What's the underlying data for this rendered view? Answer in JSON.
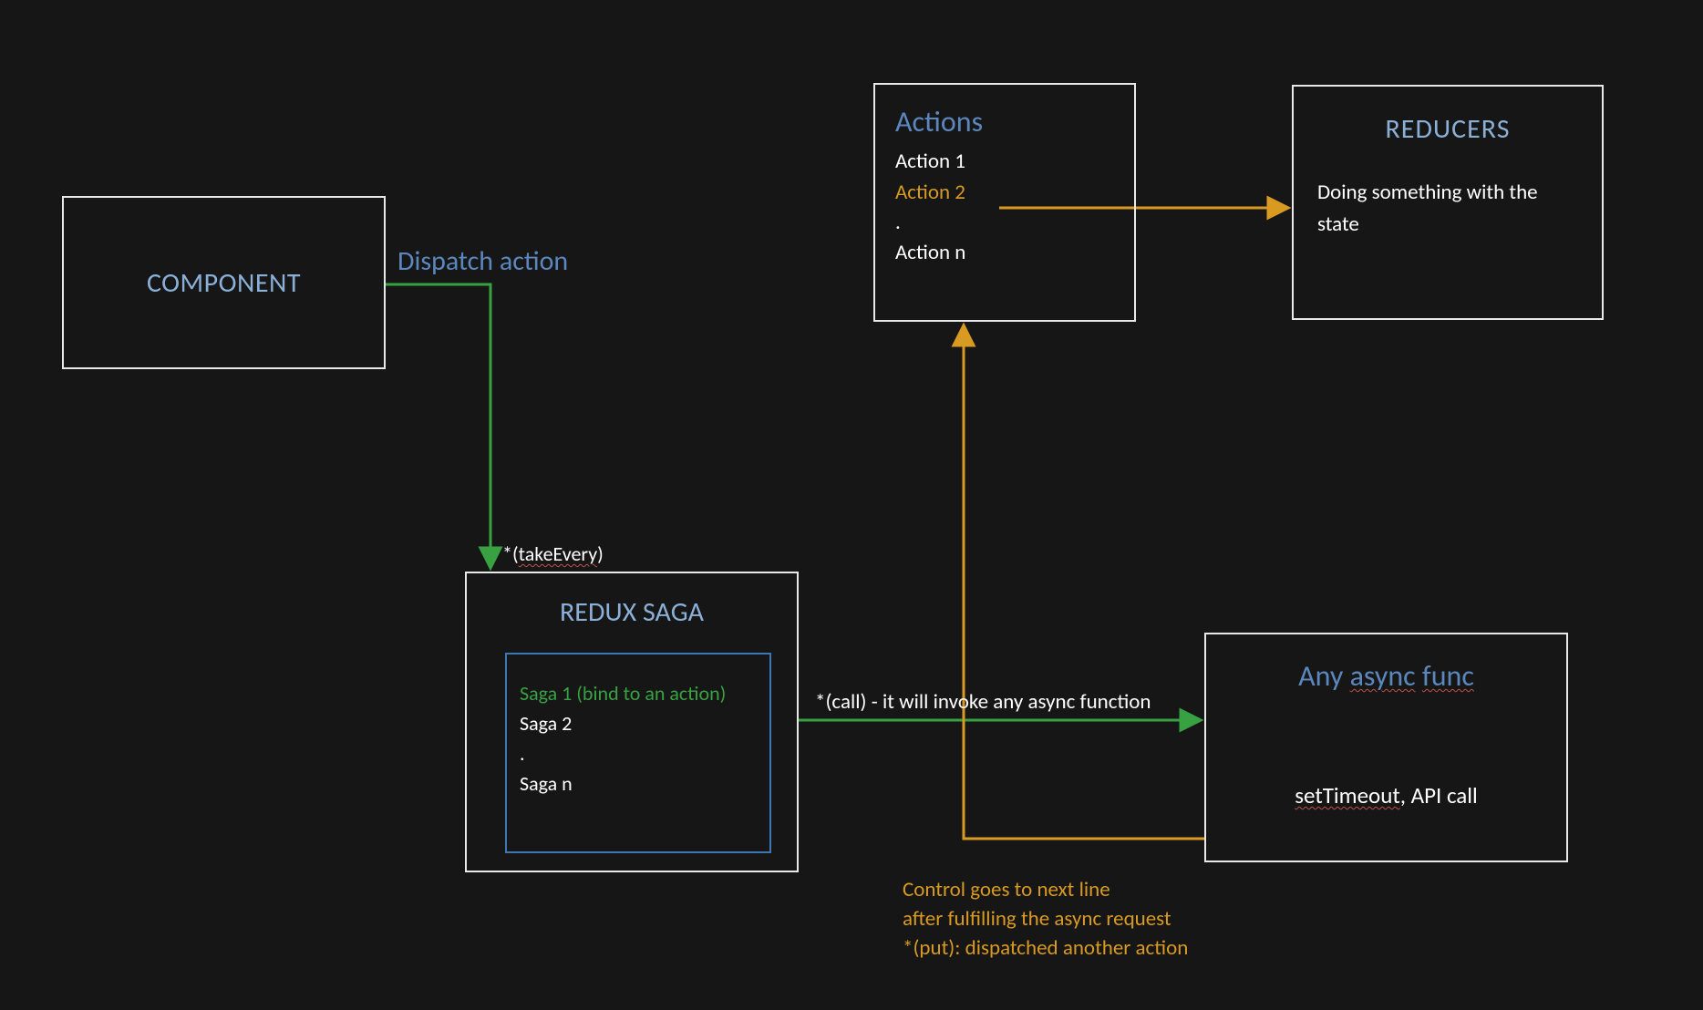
{
  "component": {
    "title": "COMPONENT"
  },
  "dispatch_label": "Dispatch action",
  "takeevery_label": "*(takeEvery)",
  "saga": {
    "title": "REDUX SAGA",
    "items": {
      "saga1": "Saga 1 (bind to an action)",
      "saga2": "Saga 2",
      "dot": ".",
      "sagan": "Saga n"
    }
  },
  "actions": {
    "title": "Actions",
    "a1": "Action 1",
    "a2": "Action 2",
    "dot": ".",
    "an": "Action n"
  },
  "reducers": {
    "title": "REDUCERS",
    "body": "Doing something with the state"
  },
  "call_label": "*(call) - it will invoke any async function",
  "async": {
    "title": "Any async func",
    "body_1": "setTimeout",
    "body_2": ", API call"
  },
  "control_label_l1": "Control goes to next line",
  "control_label_l2": "after fulfilling the async request",
  "control_label_l3": "*(put): dispatched another action"
}
